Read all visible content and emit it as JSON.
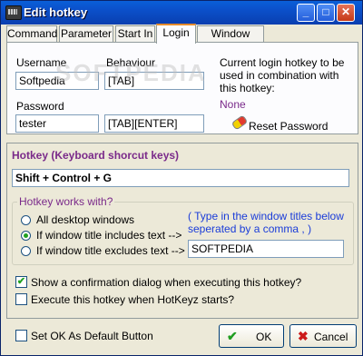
{
  "window": {
    "title": "Edit hotkey"
  },
  "tabs": [
    {
      "label": "Command"
    },
    {
      "label": "Parameter"
    },
    {
      "label": "Start In"
    },
    {
      "label": "Login"
    },
    {
      "label": "Window State"
    }
  ],
  "login": {
    "username_label": "Username",
    "username_value": "Softpedia",
    "behaviour_label": "Behaviour",
    "behaviour_value": "[TAB]",
    "password_label": "Password",
    "password_value": "tester",
    "password_behaviour_value": "[TAB][ENTER]",
    "info_text": "Current login hotkey to be used in combination with this hotkey:",
    "current_value": "None",
    "reset_label": "Reset Password"
  },
  "watermark": "SOFTPEDIA",
  "hotkey": {
    "section_title": "Hotkey (Keyboard shorcut keys)",
    "value": "Shift + Control + G",
    "works_with_title": "Hotkey works with?",
    "options": [
      {
        "label": "All desktop windows",
        "selected": false
      },
      {
        "label": "If window title includes text -->",
        "selected": true
      },
      {
        "label": "If window title excludes text -->",
        "selected": false
      }
    ],
    "hint": "( Type in the window titles below seperated by a comma , )",
    "title_filter_value": "SOFTPEDIA",
    "confirm_label": "Show a confirmation dialog when executing this hotkey?",
    "confirm_checked": true,
    "execute_label": "Execute this hotkey when HotKeyz starts?",
    "execute_checked": false
  },
  "footer": {
    "default_label": "Set OK As Default Button",
    "default_checked": false,
    "ok_label": "OK",
    "cancel_label": "Cancel"
  },
  "colors": {
    "accent": "#7a2a8a",
    "titlebar": "#0b4fc9",
    "ok_icon": "#1f9d1f",
    "cancel_icon": "#cc1a1a"
  }
}
